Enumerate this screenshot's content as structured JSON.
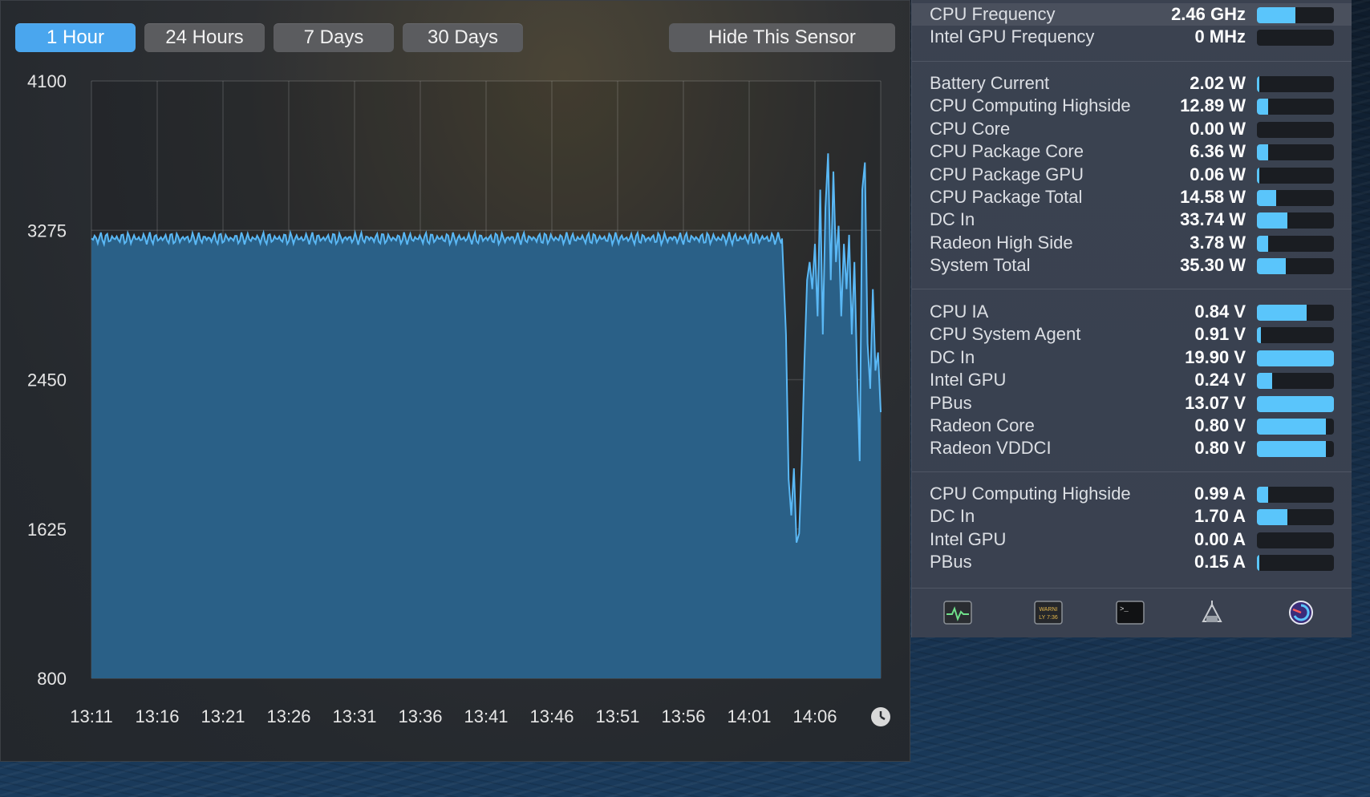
{
  "colors": {
    "accent": "#4aa6ee",
    "chart_fill": "#2a6087",
    "chart_line": "#5ab8f5",
    "bar_fill": "#5ac5fb",
    "bar_track": "#1a1d22"
  },
  "graph": {
    "range_buttons": [
      "1 Hour",
      "24 Hours",
      "7 Days",
      "30 Days"
    ],
    "active_range": "1 Hour",
    "hide_button": "Hide This Sensor",
    "clock_icon": "clock-icon"
  },
  "chart_data": {
    "type": "area",
    "title": "",
    "xlabel": "",
    "ylabel": "",
    "y_ticks": [
      4100,
      3275,
      2450,
      1625,
      800
    ],
    "ylim": [
      800,
      4100
    ],
    "x_ticks": [
      "13:11",
      "13:16",
      "13:21",
      "13:26",
      "13:31",
      "13:36",
      "13:41",
      "13:46",
      "13:51",
      "13:56",
      "14:01",
      "14:06"
    ],
    "x_minutes_range": [
      0,
      60
    ],
    "grid": true,
    "series": [
      {
        "name": "",
        "points": [
          [
            0,
            3230
          ],
          [
            52.5,
            3230
          ],
          [
            52.8,
            2700
          ],
          [
            53.0,
            1900
          ],
          [
            53.2,
            1700
          ],
          [
            53.4,
            1960
          ],
          [
            53.6,
            1550
          ],
          [
            53.8,
            1600
          ],
          [
            54.0,
            2000
          ],
          [
            54.2,
            2550
          ],
          [
            54.4,
            3000
          ],
          [
            54.6,
            3100
          ],
          [
            54.8,
            2950
          ],
          [
            55.0,
            3200
          ],
          [
            55.2,
            2800
          ],
          [
            55.4,
            3500
          ],
          [
            55.6,
            2700
          ],
          [
            55.8,
            3400
          ],
          [
            56.0,
            3700
          ],
          [
            56.2,
            3000
          ],
          [
            56.4,
            3600
          ],
          [
            56.6,
            3100
          ],
          [
            56.8,
            3300
          ],
          [
            57.0,
            2800
          ],
          [
            57.2,
            3200
          ],
          [
            57.4,
            2950
          ],
          [
            57.6,
            3250
          ],
          [
            57.8,
            2700
          ],
          [
            58.0,
            3100
          ],
          [
            58.2,
            2500
          ],
          [
            58.4,
            2000
          ],
          [
            58.6,
            3500
          ],
          [
            58.8,
            3650
          ],
          [
            59.0,
            2650
          ],
          [
            59.2,
            2400
          ],
          [
            59.4,
            2950
          ],
          [
            59.6,
            2500
          ],
          [
            59.8,
            2600
          ],
          [
            60,
            2270
          ]
        ]
      }
    ]
  },
  "sensors": {
    "frequency": [
      {
        "label": "CPU Frequency",
        "value": "2.46 GHz",
        "level": 0.5
      },
      {
        "label": "Intel GPU Frequency",
        "value": "0 MHz",
        "level": 0.0
      }
    ],
    "power": [
      {
        "label": "Battery Current",
        "value": "2.02 W",
        "level": 0.02
      },
      {
        "label": "CPU Computing Highside",
        "value": "12.89 W",
        "level": 0.15
      },
      {
        "label": "CPU Core",
        "value": "0.00 W",
        "level": 0.0
      },
      {
        "label": "CPU Package Core",
        "value": "6.36 W",
        "level": 0.15
      },
      {
        "label": "CPU Package GPU",
        "value": "0.06 W",
        "level": 0.02
      },
      {
        "label": "CPU Package Total",
        "value": "14.58 W",
        "level": 0.25
      },
      {
        "label": "DC In",
        "value": "33.74 W",
        "level": 0.4
      },
      {
        "label": "Radeon High Side",
        "value": "3.78 W",
        "level": 0.15
      },
      {
        "label": "System Total",
        "value": "35.30 W",
        "level": 0.38
      }
    ],
    "voltage": [
      {
        "label": "CPU IA",
        "value": "0.84 V",
        "level": 0.65
      },
      {
        "label": "CPU System Agent",
        "value": "0.91 V",
        "level": 0.05
      },
      {
        "label": "DC In",
        "value": "19.90 V",
        "level": 1.0
      },
      {
        "label": "Intel GPU",
        "value": "0.24 V",
        "level": 0.2
      },
      {
        "label": "PBus",
        "value": "13.07 V",
        "level": 1.0
      },
      {
        "label": "Radeon Core",
        "value": "0.80 V",
        "level": 0.9
      },
      {
        "label": "Radeon VDDCI",
        "value": "0.80 V",
        "level": 0.9
      }
    ],
    "current": [
      {
        "label": "CPU Computing Highside",
        "value": "0.99 A",
        "level": 0.15
      },
      {
        "label": "DC In",
        "value": "1.70 A",
        "level": 0.4
      },
      {
        "label": "Intel GPU",
        "value": "0.00 A",
        "level": 0.0
      },
      {
        "label": "PBus",
        "value": "0.15 A",
        "level": 0.02
      }
    ]
  },
  "toolbar": {
    "icons": [
      "activity-monitor-icon",
      "console-icon",
      "terminal-icon",
      "system-info-icon",
      "istat-menus-icon"
    ],
    "console_text": "WARNI\nLY 7:36",
    "terminal_prompt": ">_"
  }
}
